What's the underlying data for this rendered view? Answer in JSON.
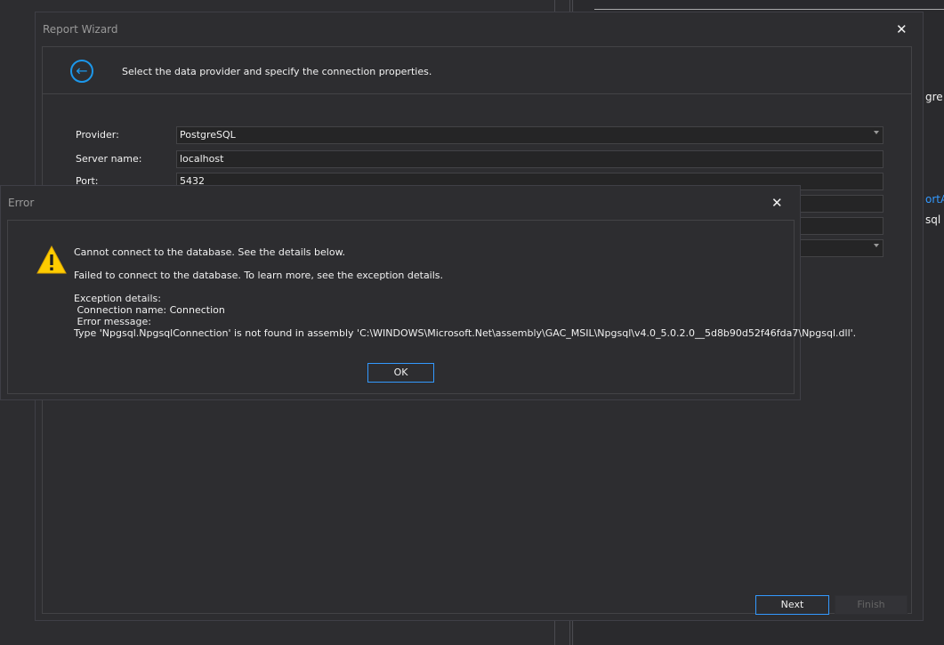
{
  "background": {
    "right_text_1": "gre",
    "right_link": "ortAl",
    "right_text_2": "sql"
  },
  "wizard": {
    "title": "Report Wizard",
    "instruction": "Select the data provider and specify the connection properties.",
    "provider_label": "Provider:",
    "provider_value": "PostgreSQL",
    "server_label": "Server name:",
    "server_value": "localhost",
    "port_label": "Port:",
    "port_value": "5432",
    "next_label": "Next",
    "finish_label": "Finish"
  },
  "error": {
    "title": "Error",
    "line1": "Cannot connect to the database. See the details below.",
    "line2": "Failed to connect to the database. To learn more, see the exception details.",
    "details_header": "Exception details:",
    "connection_name": " Connection name: Connection",
    "error_message_label": " Error message:",
    "exception_text": "Type 'Npgsql.NpgsqlConnection' is not found in assembly 'C:\\WINDOWS\\Microsoft.Net\\assembly\\GAC_MSIL\\Npgsql\\v4.0_5.0.2.0__5d8b90d52f46fda7\\Npgsql.dll'.",
    "ok_label": "OK"
  },
  "colors": {
    "accent": "#1c97ea",
    "background": "#2d2d30",
    "warning": "#ffcc00"
  }
}
